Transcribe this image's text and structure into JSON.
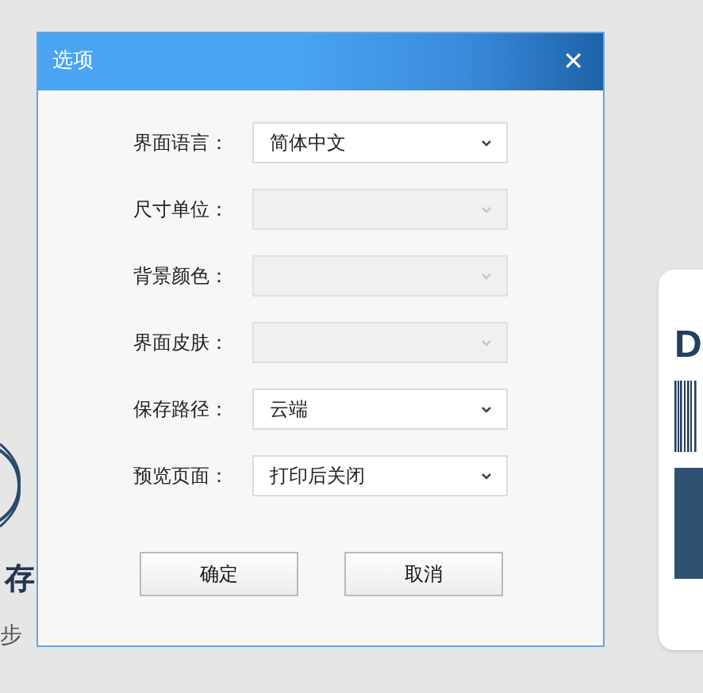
{
  "background": {
    "texts": [
      "存",
      "步",
      "D"
    ]
  },
  "dialog": {
    "title": "选项",
    "close": "✕",
    "fields": [
      {
        "label": "界面语言：",
        "value": "简体中文",
        "disabled": false
      },
      {
        "label": "尺寸单位：",
        "disabled": true
      },
      {
        "label": "背景颜色：",
        "disabled": true
      },
      {
        "label": "界面皮肤：",
        "disabled": true
      },
      {
        "label": "保存路径：",
        "value": "云端",
        "disabled": false
      },
      {
        "label": "预览页面：",
        "value": "打印后关闭",
        "disabled": false
      }
    ],
    "buttons": [
      "确定",
      "取消"
    ]
  }
}
